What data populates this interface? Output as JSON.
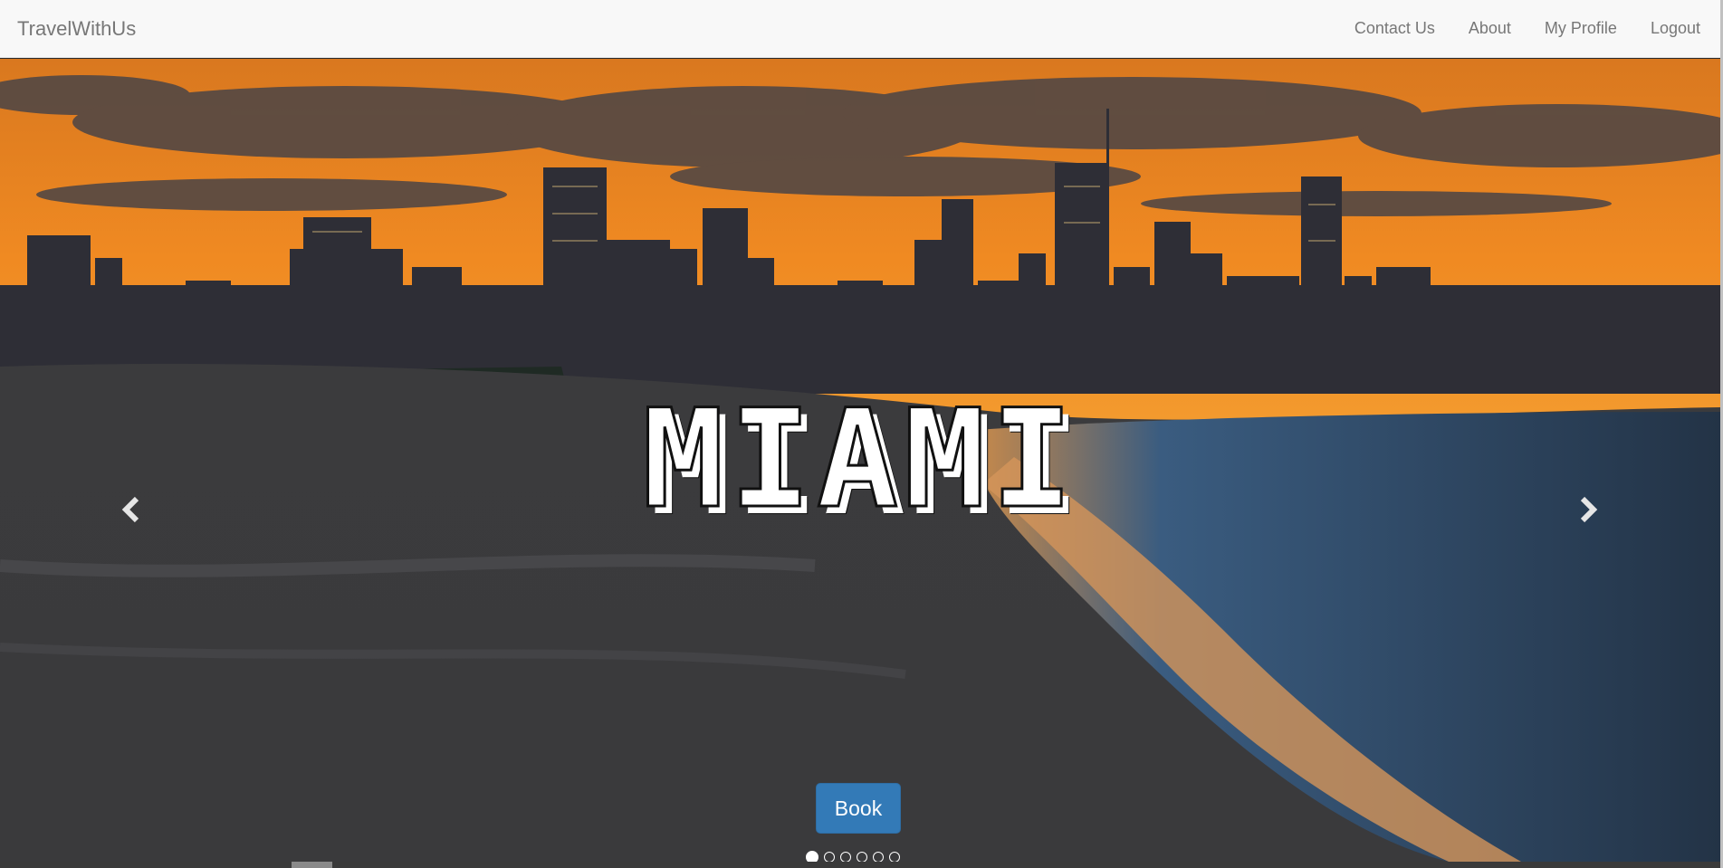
{
  "navbar": {
    "brand": "TravelWithUs",
    "links": [
      {
        "label": "Contact Us"
      },
      {
        "label": "About"
      },
      {
        "label": "My Profile"
      },
      {
        "label": "Logout"
      }
    ]
  },
  "carousel": {
    "slide_title": "MIAMI",
    "book_label": "Book",
    "prev_icon": "chevron-left-icon",
    "next_icon": "chevron-right-icon",
    "indicator_count": 6,
    "active_indicator": 1
  },
  "colors": {
    "navbar_bg": "#f8f8f8",
    "nav_text": "#777777",
    "button_primary": "#337ab7"
  }
}
